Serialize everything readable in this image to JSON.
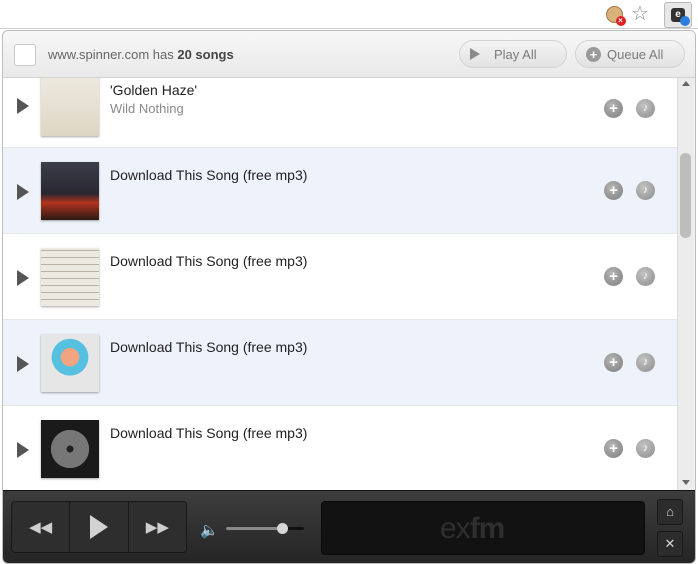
{
  "browser": {
    "star_glyph": "☆",
    "ext_glyph": "e"
  },
  "header": {
    "site": "www.spinner.com",
    "has": " has ",
    "count": "20 songs",
    "play_all": "Play All",
    "queue_all": "Queue All"
  },
  "songs": [
    {
      "title": "'Golden Haze'",
      "artist": "Wild Nothing"
    },
    {
      "title": "Download This Song (free mp3)",
      "artist": ""
    },
    {
      "title": "Download This Song (free mp3)",
      "artist": ""
    },
    {
      "title": "Download This Song (free mp3)",
      "artist": ""
    },
    {
      "title": "Download This Song (free mp3)",
      "artist": ""
    }
  ],
  "icons": {
    "add": "+",
    "note": "♪",
    "rewind": "◀◀",
    "forward": "▶▶",
    "volume": "🔈",
    "home": "⌂",
    "close": "✕"
  },
  "player": {
    "volume": 0.72,
    "logo_ex": "ex",
    "logo_fm": "fm"
  },
  "colors": {
    "row_alt": "#eef3fb",
    "player_bg": "#2e2e2e"
  }
}
